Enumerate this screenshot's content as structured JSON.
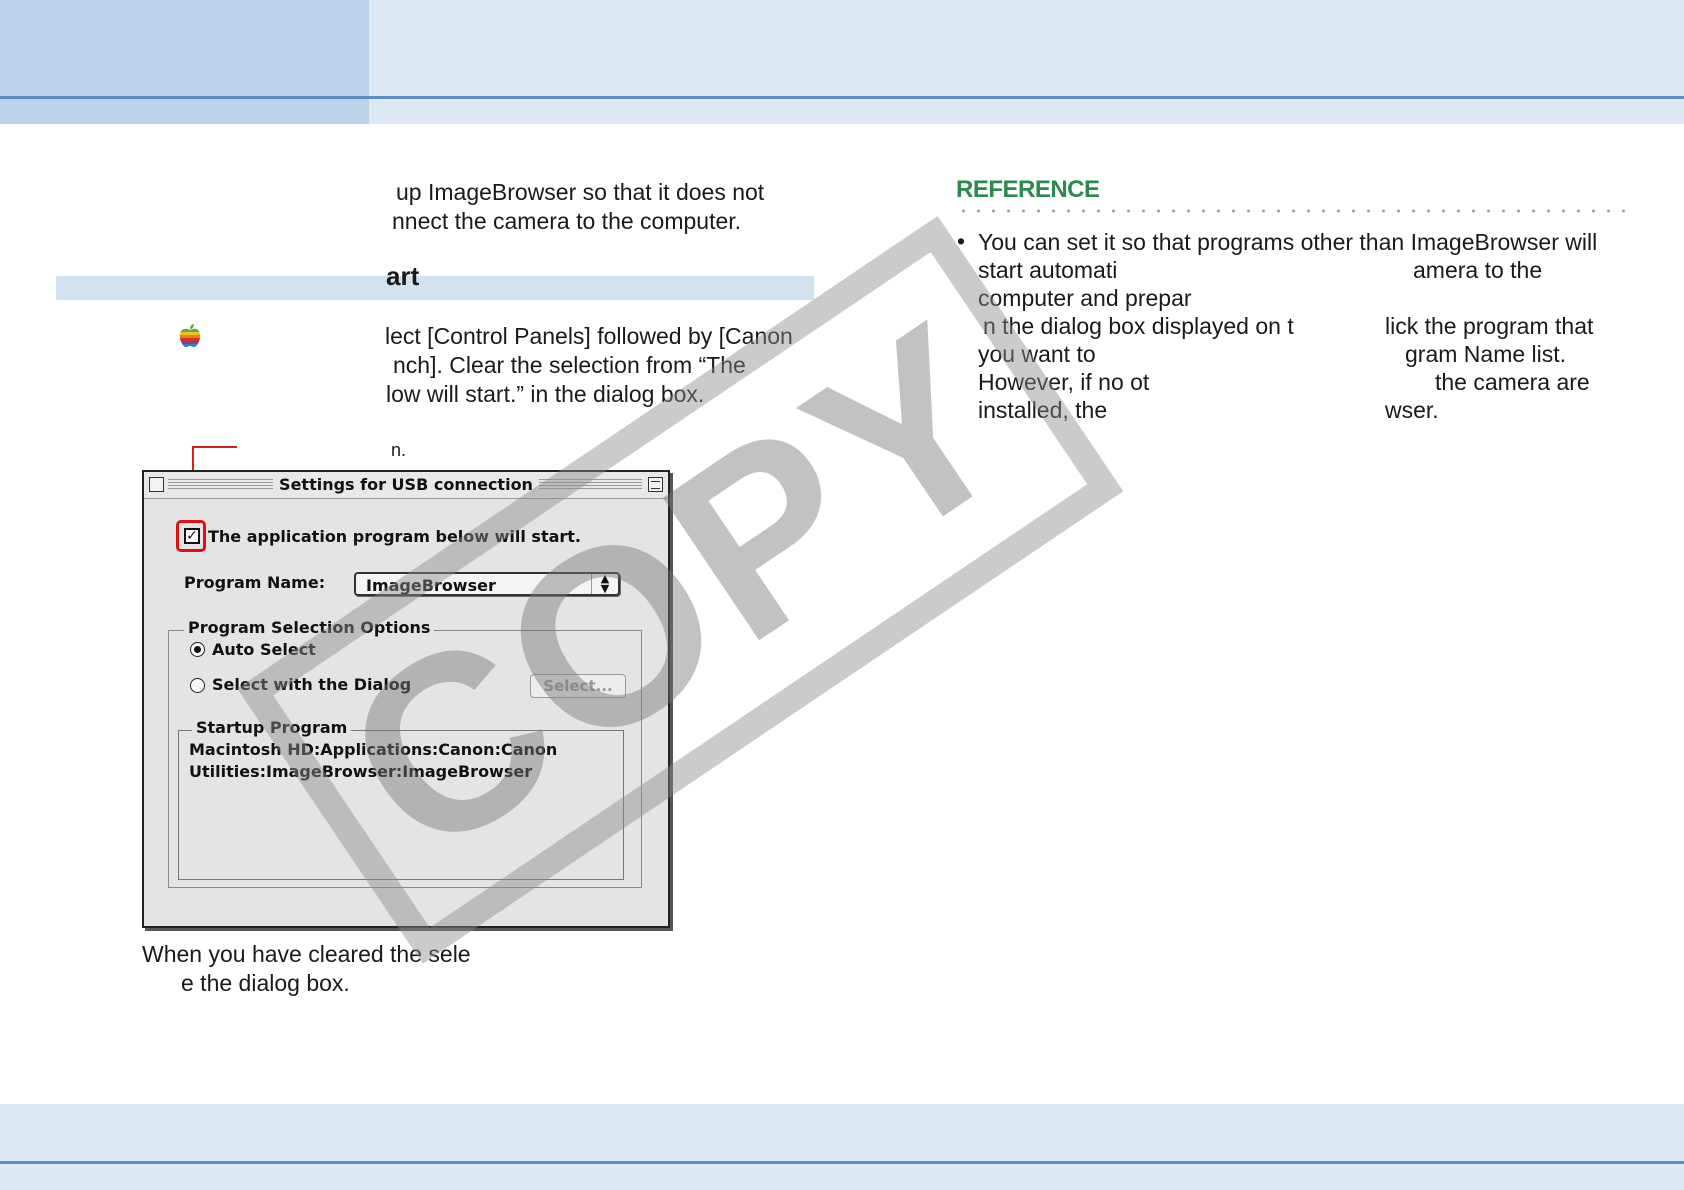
{
  "left_column": {
    "intro_line_1": "up ImageBrowser so that it does not",
    "intro_line_2": "nnect the camera to the computer.",
    "heading": "art",
    "step_line_1": "lect [Control Panels] followed by [Canon",
    "step_line_2": "nch]. Clear the selection from “The",
    "step_line_3": "low will start.” in the dialog box.",
    "callout_label": "n.",
    "caption_line_1": "When you have cleared the sele",
    "caption_line_2": "e the dialog box."
  },
  "dialog": {
    "title": "Settings for USB connection",
    "checkbox_label": "The application program below will start.",
    "checkbox_checked": true,
    "program_name_label": "Program Name:",
    "program_name_value": "ImageBrowser",
    "options_group_label": "Program Selection Options",
    "option_auto": "Auto Select",
    "option_dialog": "Select with the Dialog",
    "selected_option": "Auto Select",
    "select_button": "Select...",
    "startup_group_label": "Startup Program",
    "startup_path_line_1": "Macintosh HD:Applications:Canon:Canon",
    "startup_path_line_2": "Utilities:ImageBrowser:ImageBrowser"
  },
  "reference": {
    "title": "REFERENCE",
    "line_1": "You can set it so that programs other than ImageBrowser will",
    "line_2a": "start automati",
    "line_2b": "amera to the",
    "line_3": "computer and prepar",
    "line_4a": "n the dialog box displayed on t",
    "line_4b": "lick the program that",
    "line_5a": "you want to",
    "line_5b": "gram Name list.",
    "line_6a": "However, if no ot",
    "line_6b": "the camera are",
    "line_7a": "installed, the",
    "line_7b": "wser."
  },
  "watermark": "COPY",
  "colors": {
    "band": "#dfe9f4",
    "band_dark": "#bcd3ea",
    "rule": "#5b8fc4",
    "reference_green": "#2d8a4e",
    "callout_red": "#e01010"
  }
}
